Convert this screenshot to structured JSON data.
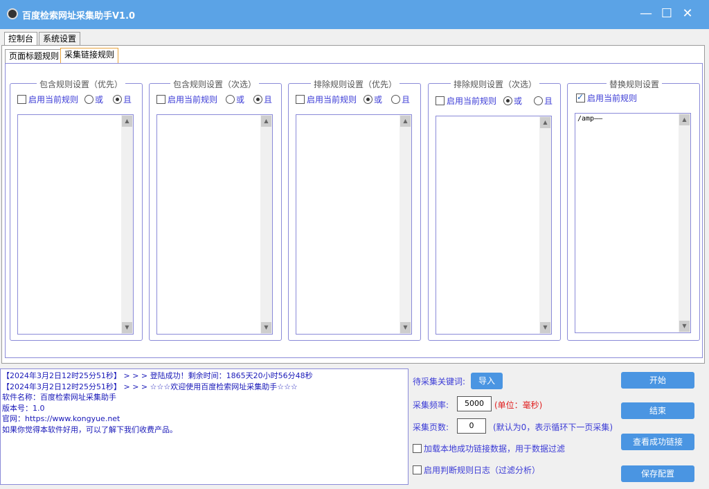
{
  "window": {
    "title": "百度检索网址采集助手V1.0"
  },
  "tabs_top": [
    "控制台",
    "系统设置"
  ],
  "tabs_sub": [
    "页面标题规则",
    "采集链接规则"
  ],
  "groups": [
    {
      "title": "包含规则设置（优先）",
      "enable_label": "启用当前规则",
      "enabled": false,
      "or_label": "或",
      "and_label": "且",
      "selected": "且",
      "content": ""
    },
    {
      "title": "包含规则设置（次选）",
      "enable_label": "启用当前规则",
      "enabled": false,
      "or_label": "或",
      "and_label": "且",
      "selected": "且",
      "content": ""
    },
    {
      "title": "排除规则设置（优先）",
      "enable_label": "启用当前规则",
      "enabled": false,
      "or_label": "或",
      "and_label": "且",
      "selected": "或",
      "content": ""
    },
    {
      "title": "排除规则设置（次选）",
      "enable_label": "启用当前规则",
      "enabled": false,
      "or_label": "或",
      "and_label": "且",
      "selected": "或",
      "content": ""
    },
    {
      "title": "替换规则设置",
      "enable_label": "启用当前规则",
      "enabled": true,
      "content": "/amp——"
    }
  ],
  "log": [
    "【2024年3月2日12时25分51秒】 > > >  登陆成功！剩余时间：1865天20小时56分48秒",
    "【2024年3月2日12时25分51秒】 > > >  ☆☆☆欢迎使用百度检索网址采集助手☆☆☆",
    "软件名称：百度检索网址采集助手",
    "版本号：1.0",
    "官网：https://www.kongyue.net",
    "如果你觉得本软件好用，可以了解下我们收费产品。"
  ],
  "controls": {
    "keyword_label": "待采集关键词:",
    "import_button": "导入",
    "freq_label": "采集频率:",
    "freq_value": "5000",
    "freq_unit": "(单位：毫秒)",
    "pages_label": "采集页数:",
    "pages_value": "0",
    "pages_note": "(默认为0，表示循环下一页采集)",
    "load_local_label": "加载本地成功链接数据，用于数据过滤",
    "load_local_checked": false,
    "enable_log_label": "启用判断规则日志（过滤分析）",
    "enable_log_checked": false,
    "start_button": "开始",
    "end_button": "结束",
    "view_button": "查看成功链接",
    "save_button": "保存配置"
  },
  "colors": {
    "titlebar": "#5ba3e6",
    "button": "#4a95e2",
    "label_blue": "#3b3bd6",
    "unit_red": "#e02020"
  }
}
